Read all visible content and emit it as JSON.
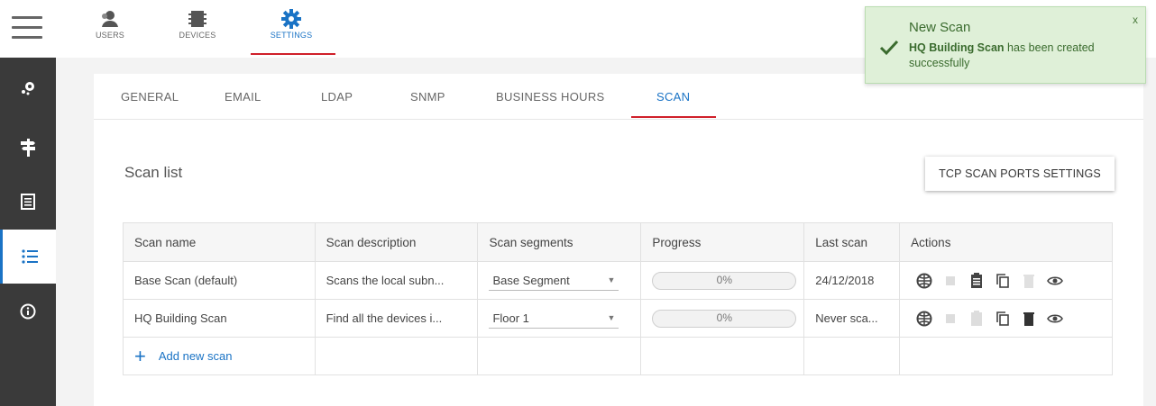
{
  "topnav": {
    "items": [
      {
        "label": "USERS",
        "icon": "users-icon"
      },
      {
        "label": "DEVICES",
        "icon": "devices-icon"
      },
      {
        "label": "SETTINGS",
        "icon": "gear-icon"
      }
    ],
    "active": "SETTINGS"
  },
  "rail": {
    "items": [
      {
        "icon": "hamburger-menu-icon"
      },
      {
        "icon": "scan-nodes-icon"
      },
      {
        "icon": "signpost-icon"
      },
      {
        "icon": "document-icon"
      },
      {
        "icon": "list-icon",
        "active": true
      },
      {
        "icon": "info-icon"
      }
    ]
  },
  "tabs": [
    "GENERAL",
    "EMAIL",
    "LDAP",
    "SNMP",
    "BUSINESS HOURS",
    "SCAN"
  ],
  "active_tab": "SCAN",
  "section": {
    "title": "Scan list",
    "tcp_button": "TCP SCAN PORTS SETTINGS"
  },
  "table": {
    "headers": [
      "Scan name",
      "Scan description",
      "Scan segments",
      "Progress",
      "Last scan",
      "Actions"
    ],
    "rows": [
      {
        "name": "Base Scan (default)",
        "description": "Scans the local subn...",
        "segment": "Base Segment",
        "progress": "0%",
        "progress_value": 0,
        "last_scan": "24/12/2018"
      },
      {
        "name": "HQ Building Scan",
        "description": "Find all the devices i...",
        "segment": "Floor 1",
        "progress": "0%",
        "progress_value": 0,
        "last_scan": "Never sca..."
      }
    ],
    "add_label": "Add new scan"
  },
  "toast": {
    "title": "New Scan",
    "name": "HQ Building Scan",
    "message": " has been created successfully",
    "close": "x"
  },
  "colors": {
    "accent": "#1a73c5",
    "active_underline": "#d0202a",
    "rail_bg": "#3a3a3a",
    "toast_bg": "#dff0d8",
    "toast_text": "#3a6b2e"
  }
}
